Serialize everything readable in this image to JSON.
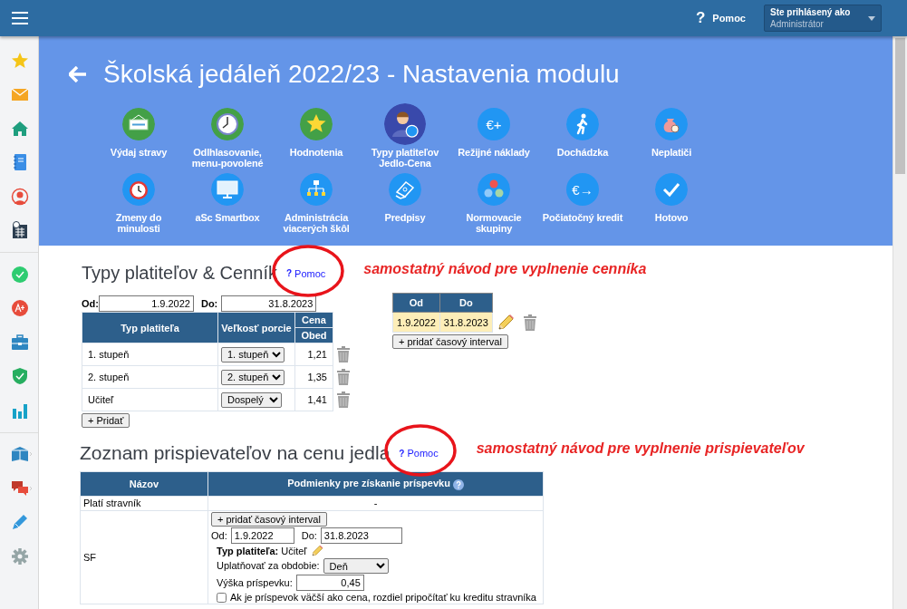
{
  "topbar": {
    "help_icon": "?",
    "help": "Pomoc",
    "user": {
      "label": "Ste prihlásený ako",
      "role": "Administrátor"
    }
  },
  "header": {
    "title": "Školská jedáleň 2022/23 - Nastavenia modulu",
    "tiles": [
      {
        "label": "Výdaj stravy",
        "selected": false
      },
      {
        "label": "Odlhlasovanie, menu-povolené",
        "selected": false
      },
      {
        "label": "Hodnotenia",
        "selected": false
      },
      {
        "label": "Typy platiteľov Jedlo-Cena",
        "selected": true
      },
      {
        "label": "Režijné náklady",
        "glyph": "€+",
        "selected": false
      },
      {
        "label": "Dochádzka",
        "selected": false
      },
      {
        "label": "Neplatiči",
        "selected": false
      },
      {
        "label": "Zmeny do minulosti",
        "selected": false
      },
      {
        "label": "aSc Smartbox",
        "selected": false
      },
      {
        "label": "Administrácia viacerých škôl",
        "selected": false
      },
      {
        "label": "Predpisy",
        "selected": false
      },
      {
        "label": "Normovacie skupiny",
        "selected": false
      },
      {
        "label": "Počiatočný kredit",
        "glyph": "€→",
        "selected": false
      },
      {
        "label": "Hotovo",
        "selected": false
      }
    ]
  },
  "prices": {
    "title": "Typy platiteľov & Cenník",
    "help": {
      "icon": "?",
      "label": "Pomoc"
    },
    "note": "samostatný návod pre vyplnenie cenníka",
    "from_label": "Od:",
    "from": "1.9.2022",
    "to_label": "Do:",
    "to": "31.8.2023",
    "columns": [
      "Typ platiteľa",
      "Veľkosť porcie"
    ],
    "price_group": "Cena",
    "price_column": "Obed",
    "rows": [
      {
        "payer": "1. stupeň",
        "portion": "1. stupeň",
        "price": "1,21"
      },
      {
        "payer": "2. stupeň",
        "portion": "2. stupeň",
        "price": "1,35"
      },
      {
        "payer": "Učiteľ",
        "portion": "Dospelý",
        "price": "1,41"
      }
    ],
    "add_button": "+ Pridať",
    "intervals": {
      "columns": [
        "Od",
        "Do"
      ],
      "rows": [
        {
          "from": "1.9.2022",
          "to": "31.8.2023",
          "selected": true
        }
      ],
      "add_button": "+ pridať časový interval"
    }
  },
  "contributors": {
    "title": "Zoznam prispievateľov na cenu jedla",
    "help": {
      "icon": "?",
      "label": "Pomoc"
    },
    "note": "samostatný návod pre vyplnenie prispievateľov",
    "columns": [
      "Názov",
      "Podmienky pre získanie príspevku"
    ],
    "rows": [
      {
        "kind": "plain",
        "name": "Platí stravník",
        "conditions": "-"
      },
      {
        "kind": "intervals",
        "name": "SF",
        "add_button": "+ pridať časový interval",
        "from_label": "Od:",
        "from": "1.9.2022",
        "to_label": "Do:",
        "to": "31.8.2023",
        "payer": "**Typ platiteľa:** Učiteľ",
        "period_label": "Uplatňovať za obdobie:",
        "period": "Deň",
        "amount_label": "Výška príspevku:",
        "amount": "0,45",
        "option": {
          "label": "Ak je príspevok väčší ako cena, rozdiel pripočítať ku kreditu stravníka",
          "checked": false
        }
      }
    ]
  }
}
